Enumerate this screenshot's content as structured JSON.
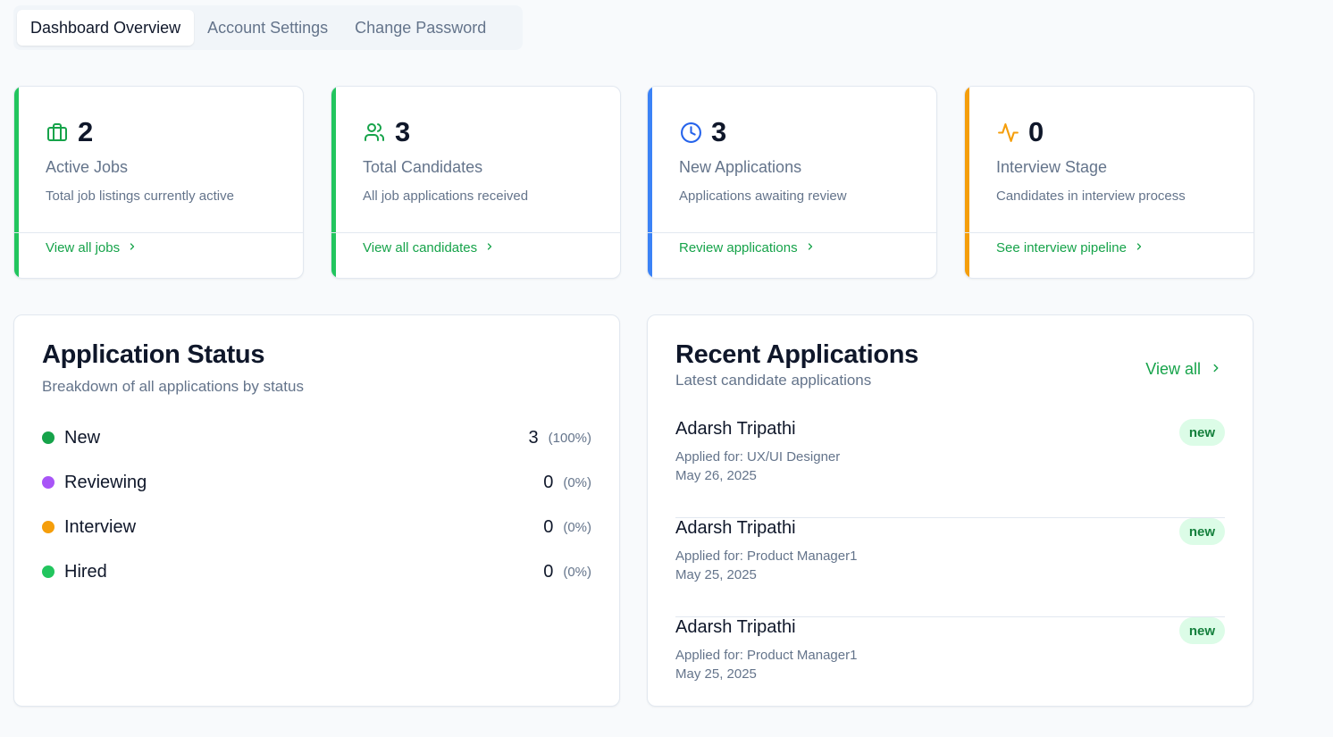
{
  "tabs": [
    {
      "label": "Dashboard Overview"
    },
    {
      "label": "Account Settings"
    },
    {
      "label": "Change Password"
    }
  ],
  "stats": [
    {
      "value": "2",
      "title": "Active Jobs",
      "desc": "Total job listings currently active",
      "link": "View all jobs",
      "icon": "briefcase-icon",
      "color": "#22c55e"
    },
    {
      "value": "3",
      "title": "Total Candidates",
      "desc": "All job applications received",
      "link": "View all candidates",
      "icon": "users-icon",
      "color": "#22c55e"
    },
    {
      "value": "3",
      "title": "New Applications",
      "desc": "Applications awaiting review",
      "link": "Review applications",
      "icon": "clock-icon",
      "color": "#3b82f6"
    },
    {
      "value": "0",
      "title": "Interview Stage",
      "desc": "Candidates in interview process",
      "link": "See interview pipeline",
      "icon": "activity-icon",
      "color": "#f59e0b"
    }
  ],
  "status_panel": {
    "title": "Application Status",
    "subtitle": "Breakdown of all applications by status",
    "rows": [
      {
        "label": "New",
        "count": "3",
        "pct": "(100%)",
        "color": "#16a34a"
      },
      {
        "label": "Reviewing",
        "count": "0",
        "pct": "(0%)",
        "color": "#a855f7"
      },
      {
        "label": "Interview",
        "count": "0",
        "pct": "(0%)",
        "color": "#f59e0b"
      },
      {
        "label": "Hired",
        "count": "0",
        "pct": "(0%)",
        "color": "#22c55e"
      }
    ]
  },
  "recent_panel": {
    "title": "Recent Applications",
    "subtitle": "Latest candidate applications",
    "view_all": "View all",
    "items": [
      {
        "name": "Adarsh Tripathi",
        "job": "Applied for: UX/UI Designer",
        "date": "May 26, 2025",
        "badge": "new"
      },
      {
        "name": "Adarsh Tripathi",
        "job": "Applied for: Product Manager1",
        "date": "May 25, 2025",
        "badge": "new"
      },
      {
        "name": "Adarsh Tripathi",
        "job": "Applied for: Product Manager1",
        "date": "May 25, 2025",
        "badge": "new"
      }
    ]
  }
}
